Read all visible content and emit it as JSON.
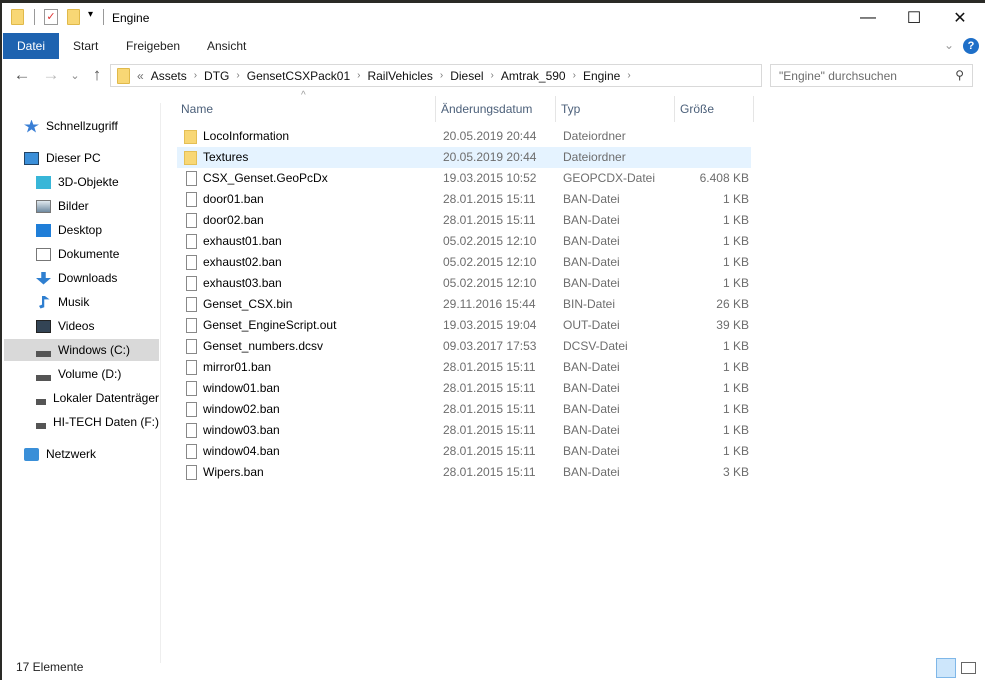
{
  "window": {
    "title": "Engine",
    "minimize": "—",
    "maximize": "☐",
    "close": "✕"
  },
  "ribbon": {
    "tabs": [
      "Datei",
      "Start",
      "Freigeben",
      "Ansicht"
    ],
    "expand": "⌄",
    "help": "?"
  },
  "nav": {
    "back": "←",
    "forward": "→",
    "recent": "⌄",
    "up": "↑",
    "path": [
      "«",
      "Assets",
      "DTG",
      "GensetCSXPack01",
      "RailVehicles",
      "Diesel",
      "Amtrak_590",
      "Engine"
    ],
    "dropdown": "⌄",
    "search_placeholder": "\"Engine\" durchsuchen"
  },
  "sidebar": {
    "items": [
      {
        "label": "Schnellzugriff",
        "icon": "star-icon"
      },
      {
        "label": "Dieser PC",
        "icon": "computer-icon"
      },
      {
        "label": "3D-Objekte",
        "icon": "cube-icon"
      },
      {
        "label": "Bilder",
        "icon": "pictures-icon"
      },
      {
        "label": "Desktop",
        "icon": "desktop-icon"
      },
      {
        "label": "Dokumente",
        "icon": "documents-icon"
      },
      {
        "label": "Downloads",
        "icon": "download-icon"
      },
      {
        "label": "Musik",
        "icon": "music-icon"
      },
      {
        "label": "Videos",
        "icon": "video-icon"
      },
      {
        "label": "Windows (C:)",
        "icon": "drive-icon"
      },
      {
        "label": "Volume (D:)",
        "icon": "drive-icon"
      },
      {
        "label": "Lokaler Datenträger",
        "icon": "drive-icon"
      },
      {
        "label": "HI-TECH Daten (F:)",
        "icon": "drive-icon"
      },
      {
        "label": "Netzwerk",
        "icon": "network-icon"
      }
    ]
  },
  "columns": [
    "Name",
    "Änderungsdatum",
    "Typ",
    "Größe"
  ],
  "files": [
    {
      "name": "LocoInformation",
      "date": "20.05.2019 20:44",
      "type": "Dateiordner",
      "size": "",
      "folder": true
    },
    {
      "name": "Textures",
      "date": "20.05.2019 20:44",
      "type": "Dateiordner",
      "size": "",
      "folder": true
    },
    {
      "name": "CSX_Genset.GeoPcDx",
      "date": "19.03.2015 10:52",
      "type": "GEOPCDX-Datei",
      "size": "6.408 KB"
    },
    {
      "name": "door01.ban",
      "date": "28.01.2015 15:11",
      "type": "BAN-Datei",
      "size": "1 KB"
    },
    {
      "name": "door02.ban",
      "date": "28.01.2015 15:11",
      "type": "BAN-Datei",
      "size": "1 KB"
    },
    {
      "name": "exhaust01.ban",
      "date": "05.02.2015 12:10",
      "type": "BAN-Datei",
      "size": "1 KB"
    },
    {
      "name": "exhaust02.ban",
      "date": "05.02.2015 12:10",
      "type": "BAN-Datei",
      "size": "1 KB"
    },
    {
      "name": "exhaust03.ban",
      "date": "05.02.2015 12:10",
      "type": "BAN-Datei",
      "size": "1 KB"
    },
    {
      "name": "Genset_CSX.bin",
      "date": "29.11.2016 15:44",
      "type": "BIN-Datei",
      "size": "26 KB"
    },
    {
      "name": "Genset_EngineScript.out",
      "date": "19.03.2015 19:04",
      "type": "OUT-Datei",
      "size": "39 KB"
    },
    {
      "name": "Genset_numbers.dcsv",
      "date": "09.03.2017 17:53",
      "type": "DCSV-Datei",
      "size": "1 KB"
    },
    {
      "name": "mirror01.ban",
      "date": "28.01.2015 15:11",
      "type": "BAN-Datei",
      "size": "1 KB"
    },
    {
      "name": "window01.ban",
      "date": "28.01.2015 15:11",
      "type": "BAN-Datei",
      "size": "1 KB"
    },
    {
      "name": "window02.ban",
      "date": "28.01.2015 15:11",
      "type": "BAN-Datei",
      "size": "1 KB"
    },
    {
      "name": "window03.ban",
      "date": "28.01.2015 15:11",
      "type": "BAN-Datei",
      "size": "1 KB"
    },
    {
      "name": "window04.ban",
      "date": "28.01.2015 15:11",
      "type": "BAN-Datei",
      "size": "1 KB"
    },
    {
      "name": "Wipers.ban",
      "date": "28.01.2015 15:11",
      "type": "BAN-Datei",
      "size": "3 KB"
    }
  ],
  "status": {
    "count": "17 Elemente"
  }
}
